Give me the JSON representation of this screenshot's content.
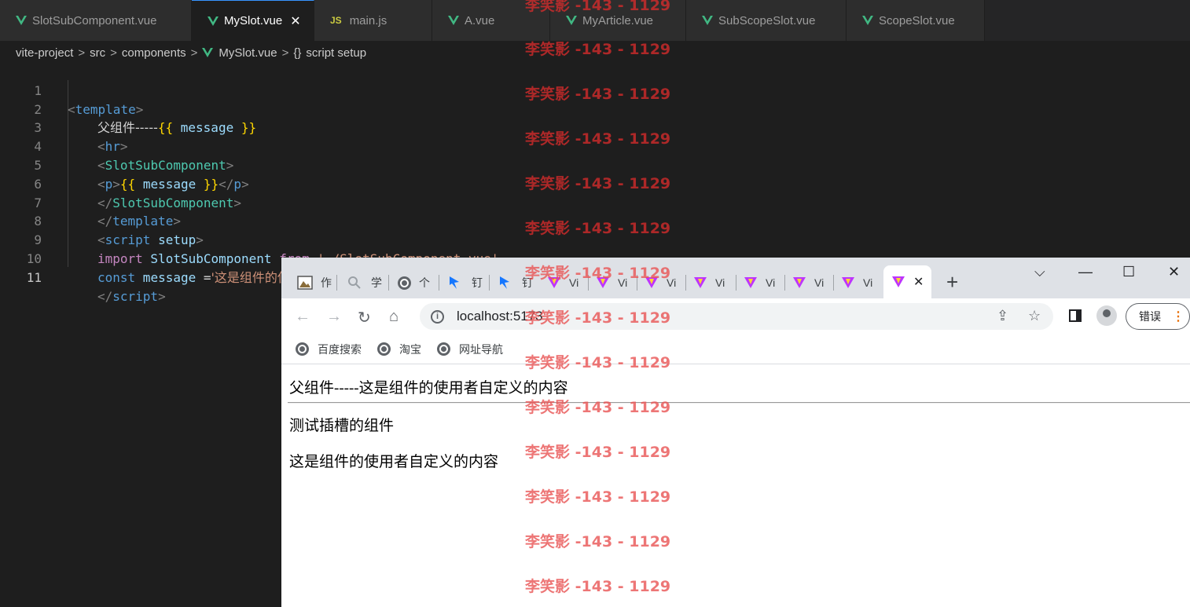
{
  "editor": {
    "tabs": [
      {
        "label": "SlotSubComponent.vue",
        "icon": "vue-icon"
      },
      {
        "label": "MySlot.vue",
        "icon": "vue-icon",
        "active": true
      },
      {
        "label": "main.js",
        "icon": "js-icon",
        "icon_text": "JS"
      },
      {
        "label": "A.vue",
        "icon": "vue-icon"
      },
      {
        "label": "MyArticle.vue",
        "icon": "vue-icon"
      },
      {
        "label": "SubScopeSlot.vue",
        "icon": "vue-icon"
      },
      {
        "label": "ScopeSlot.vue",
        "icon": "vue-icon"
      }
    ],
    "close_glyph": "✕",
    "breadcrumb": [
      "vite-project",
      "src",
      "components",
      "MySlot.vue",
      "script setup"
    ],
    "breadcrumb_sep": ">",
    "braces": "{}",
    "line_numbers": [
      "1",
      "2",
      "3",
      "4",
      "5",
      "6",
      "7",
      "8",
      "9",
      "10",
      "11"
    ],
    "code": {
      "l1": {
        "lt": "<",
        "tag": "template",
        "gt": ">"
      },
      "l2": {
        "text": "父组件-----",
        "open": "{{",
        "var": " message ",
        "close": "}}"
      },
      "l3": {
        "lt": "<",
        "tag": "hr",
        "gt": ">"
      },
      "l4": {
        "lt": "<",
        "tag": "SlotSubComponent",
        "gt": ">"
      },
      "l5": {
        "lt": "<",
        "tag": "p",
        "gt": ">",
        "open": "{{",
        "var": " message ",
        "close": "}}",
        "lt2": "</",
        "tag2": "p",
        "gt2": ">"
      },
      "l6": {
        "lt": "</",
        "tag": "SlotSubComponent",
        "gt": ">"
      },
      "l7": {
        "lt": "</",
        "tag": "template",
        "gt": ">"
      },
      "l8": {
        "lt": "<",
        "tag": "script",
        "attr": " setup",
        "gt": ">"
      },
      "l9": {
        "kw": "import",
        "name": " SlotSubComponent ",
        "kw2": "from",
        "str": " './SlotSubComponent.vue'"
      },
      "l10": {
        "kw": "const",
        "var": " message ",
        "op": "=",
        "str": "'这是组件的使用者自定义的内容'"
      },
      "l11": {
        "lt": "</",
        "tag": "script",
        "gt": ">"
      }
    }
  },
  "browser": {
    "tabs": [
      {
        "label": "作",
        "icon": "image-icon"
      },
      {
        "label": "学",
        "icon": "search-icon"
      },
      {
        "label": "个",
        "icon": "globe-icon"
      },
      {
        "label": "钉",
        "icon": "dingtalk-icon"
      },
      {
        "label": "钉",
        "icon": "dingtalk-icon"
      },
      {
        "label": "Vi",
        "icon": "vite-icon"
      },
      {
        "label": "Vi",
        "icon": "vite-icon"
      },
      {
        "label": "Vi",
        "icon": "vite-icon"
      },
      {
        "label": "Vi",
        "icon": "vite-icon"
      },
      {
        "label": "Vi",
        "icon": "vite-icon"
      },
      {
        "label": "Vi",
        "icon": "vite-icon"
      },
      {
        "label": "Vi",
        "icon": "vite-icon"
      }
    ],
    "active_tab_icon": "vite-icon",
    "close_glyph": "✕",
    "new_tab": "+",
    "controls": {
      "dropdown": "⌵",
      "minimize": "—",
      "maximize": "☐",
      "close": "✕"
    },
    "nav": {
      "back": "←",
      "forward": "→",
      "reload": "↻",
      "home": "⌂"
    },
    "url": "localhost:5173",
    "info": "i",
    "share_glyph": "⇪",
    "star_glyph": "☆",
    "error_button": "错误",
    "menu_glyph": "⋮",
    "bookmarks": [
      "百度搜索",
      "淘宝",
      "网址导航"
    ],
    "page": {
      "heading": "父组件-----这是组件的使用者自定义的内容",
      "line1": "测试插槽的组件",
      "line2": "这是组件的使用者自定义的内容"
    }
  },
  "watermark": {
    "text": "李笑影 -143 - 1129"
  },
  "colors": {
    "vue_green": "#41b883",
    "vscode_accent": "#3794ff",
    "watermark": "#d62c2c"
  }
}
